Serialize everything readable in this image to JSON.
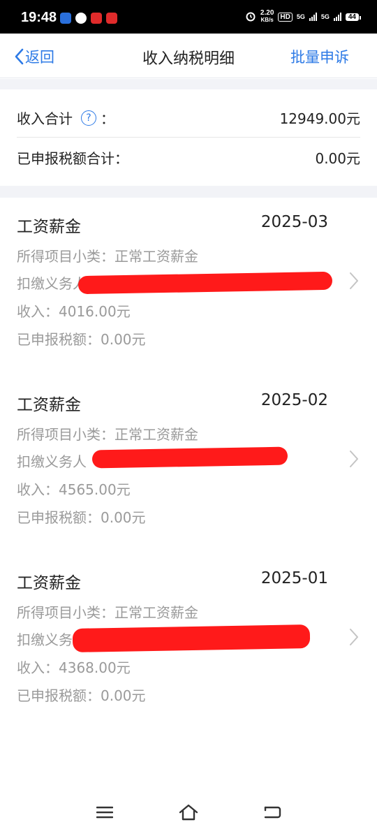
{
  "status_bar": {
    "time": "19:48",
    "net_speed_value": "2.20",
    "net_speed_unit": "KB/s",
    "hd_label": "HD",
    "sim1": "5G",
    "sim2": "5G",
    "battery": "44"
  },
  "nav": {
    "back_label": "返回",
    "title": "收入纳税明细",
    "action_label": "批量申诉"
  },
  "summary": {
    "income_label": "收入合计",
    "income_colon": "：",
    "income_value": "12949.00元",
    "tax_label": "已申报税额合计：",
    "tax_value": "0.00元"
  },
  "records": [
    {
      "type": "工资薪金",
      "month": "2025-03",
      "subcategory": "所得项目小类：正常工资薪金",
      "payer_prefix": "扣缴义务人",
      "income": "收入：4016.00元",
      "tax": "已申报税额：0.00元"
    },
    {
      "type": "工资薪金",
      "month": "2025-02",
      "subcategory": "所得项目小类：正常工资薪金",
      "payer_prefix": "扣缴义务人",
      "income": "收入：4565.00元",
      "tax": "已申报税额：0.00元"
    },
    {
      "type": "工资薪金",
      "month": "2025-01",
      "subcategory": "所得项目小类：正常工资薪金",
      "payer_prefix": "扣缴义务",
      "income": "收入：4368.00元",
      "tax": "已申报税额：0.00元"
    }
  ],
  "colors": {
    "accent": "#2d7ae6",
    "redaction": "#ff1a1a",
    "secondary_text": "#9a9a9a",
    "section_gap": "#f2f3f7"
  },
  "icons": {
    "back": "chevron-left-icon",
    "help": "question-circle-icon",
    "row": "chevron-right-icon",
    "menu": "menu-icon",
    "home": "home-icon",
    "return": "return-icon"
  }
}
